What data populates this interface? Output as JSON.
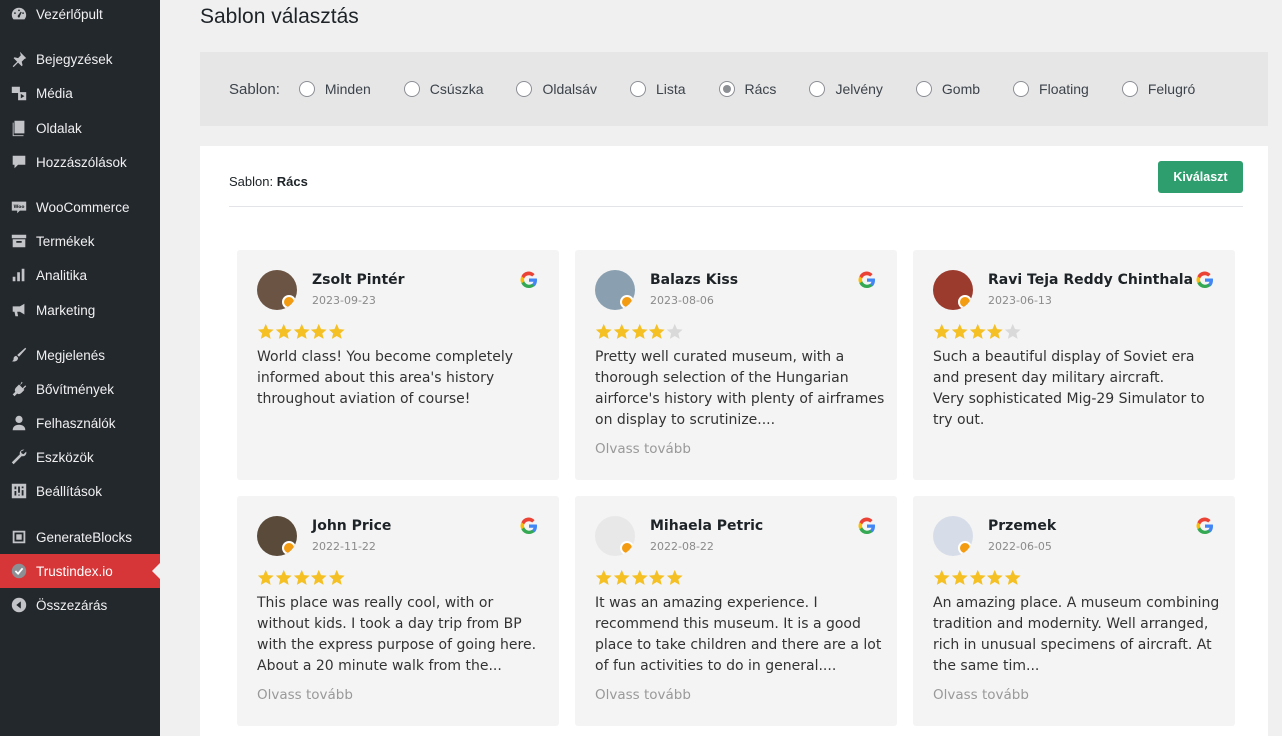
{
  "sidebar": {
    "items": [
      {
        "label": "Vezérlőpult",
        "icon": "dashboard-icon"
      },
      {
        "label": "Bejegyzések",
        "icon": "pin-icon"
      },
      {
        "label": "Média",
        "icon": "media-icon"
      },
      {
        "label": "Oldalak",
        "icon": "pages-icon"
      },
      {
        "label": "Hozzászólások",
        "icon": "comments-icon"
      },
      {
        "label": "WooCommerce",
        "icon": "woo-icon"
      },
      {
        "label": "Termékek",
        "icon": "archive-icon"
      },
      {
        "label": "Analitika",
        "icon": "bar-chart-icon"
      },
      {
        "label": "Marketing",
        "icon": "megaphone-icon"
      },
      {
        "label": "Megjelenés",
        "icon": "brush-icon"
      },
      {
        "label": "Bővítmények",
        "icon": "plugin-icon"
      },
      {
        "label": "Felhasználók",
        "icon": "user-icon"
      },
      {
        "label": "Eszközök",
        "icon": "wrench-icon"
      },
      {
        "label": "Beállítások",
        "icon": "settings-icon"
      },
      {
        "label": "GenerateBlocks",
        "icon": "blocks-icon"
      },
      {
        "label": "Trustindex.io",
        "icon": "check-circle-icon"
      },
      {
        "label": "Összezárás",
        "icon": "collapse-icon"
      }
    ],
    "active_color": "#d63638"
  },
  "page": {
    "title": "Sablon választás"
  },
  "filter": {
    "label": "Sablon:",
    "options": [
      "Minden",
      "Csúszka",
      "Oldalsáv",
      "Lista",
      "Rács",
      "Jelvény",
      "Gomb",
      "Floating",
      "Felugró"
    ],
    "selected": "Rács"
  },
  "panel": {
    "label": "Sablon:",
    "value": "Rács",
    "button": "Kiválaszt",
    "button_color": "#2f9e6e"
  },
  "reviews": [
    {
      "name": "Zsolt Pintér",
      "date": "2023-09-23",
      "rating": 5,
      "text": "World class! You become completely informed about this area's history throughout aviation of course!",
      "more": ""
    },
    {
      "name": "Balazs Kiss",
      "date": "2023-08-06",
      "rating": 4,
      "text": "Pretty well curated museum, with a thorough selection of the Hungarian airforce's history with plenty of airframes on display to scrutinize....",
      "more": "Olvass tovább"
    },
    {
      "name": "Ravi Teja Reddy Chinthala",
      "date": "2023-06-13",
      "rating": 4,
      "text": "Such a beautiful display of Soviet era and present day military aircraft.\nVery sophisticated Mig-29 Simulator to try out.",
      "more": ""
    },
    {
      "name": "John Price",
      "date": "2022-11-22",
      "rating": 5,
      "text": "This place was really cool, with or without kids. I took a day trip from BP with the express purpose of going here. About a 20 minute walk from the...",
      "more": "Olvass tovább"
    },
    {
      "name": "Mihaela Petric",
      "date": "2022-08-22",
      "rating": 5,
      "text": "It was an amazing experience. I recommend this museum. It is a good place to take children and there are a lot of fun activities to do in general....",
      "more": "Olvass tovább"
    },
    {
      "name": "Przemek",
      "date": "2022-06-05",
      "rating": 5,
      "text": "An amazing place. A museum combining tradition and modernity. Well arranged, rich in unusual specimens of aircraft. At the same tim...",
      "more": "Olvass tovább"
    }
  ],
  "colors": {
    "star": "#f4c023",
    "star_empty": "#d9d9d9"
  }
}
